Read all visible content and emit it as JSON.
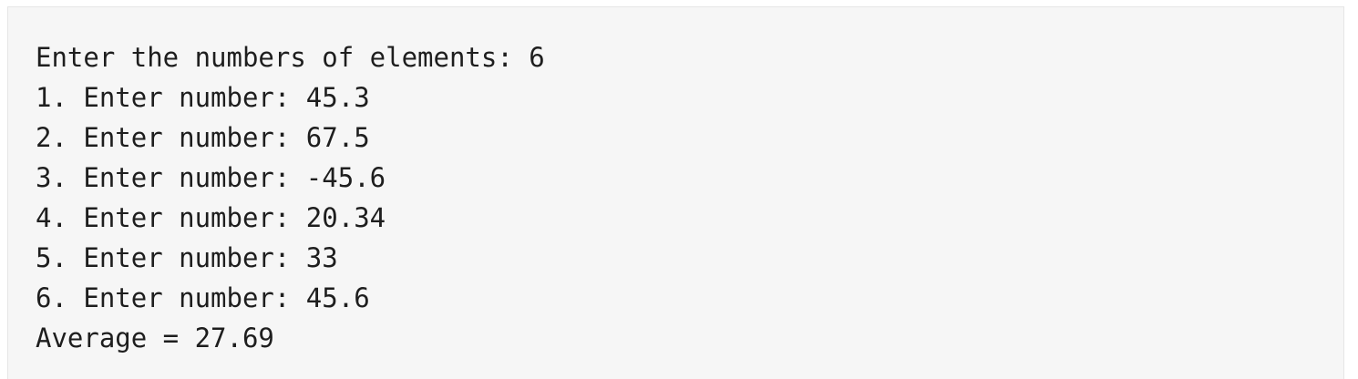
{
  "console": {
    "lines": [
      "Enter the numbers of elements: 6",
      "1. Enter number: 45.3",
      "2. Enter number: 67.5",
      "3. Enter number: -45.6",
      "4. Enter number: 20.34",
      "5. Enter number: 33",
      "6. Enter number: 45.6",
      "Average = 27.69"
    ]
  }
}
